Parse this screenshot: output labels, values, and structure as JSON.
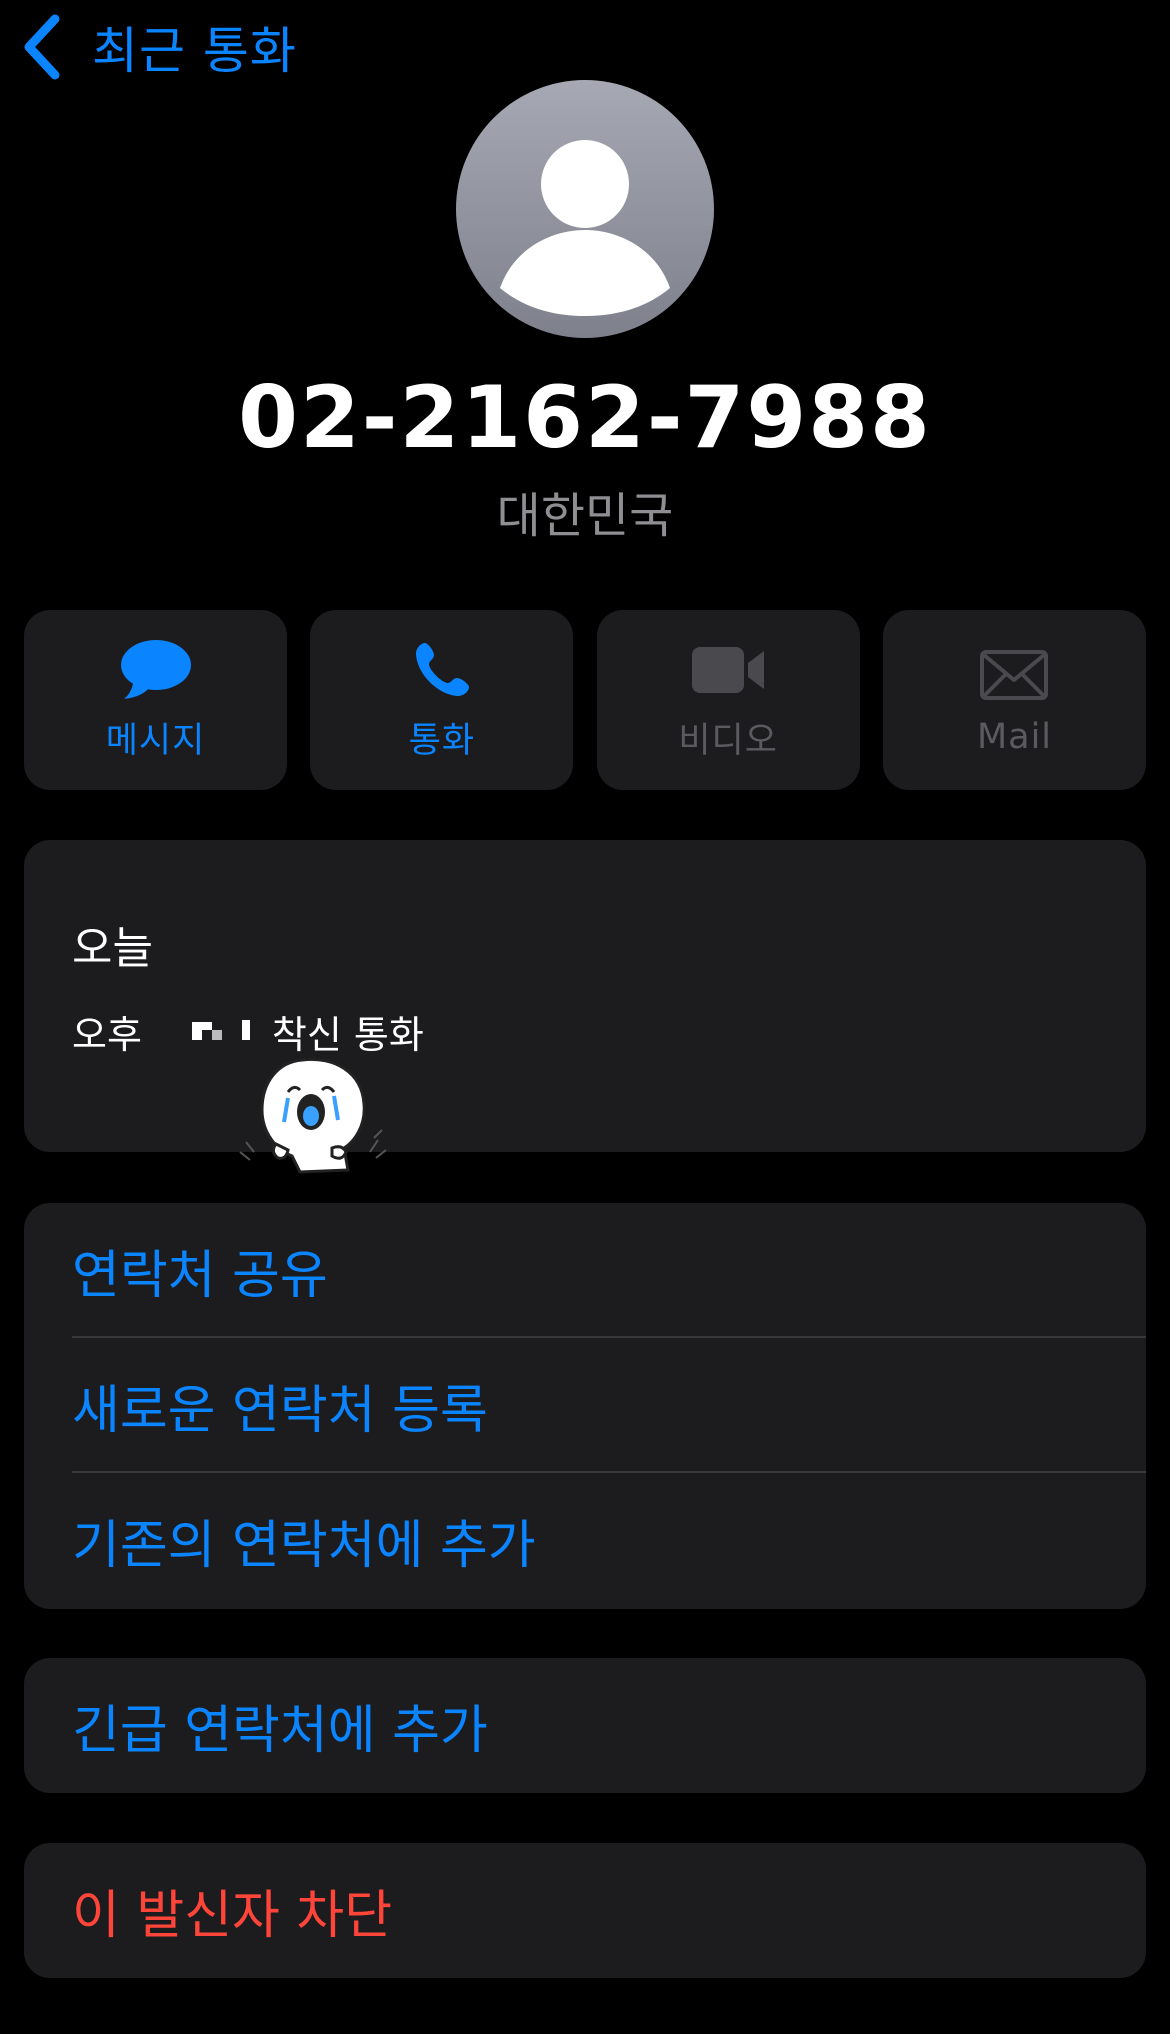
{
  "nav": {
    "back_label": "최근 통화"
  },
  "contact": {
    "phone_number": "02-2162-7988",
    "country": "대한민국"
  },
  "actions": [
    {
      "label": "메시지",
      "icon": "message-bubble-icon",
      "enabled": true
    },
    {
      "label": "통화",
      "icon": "phone-icon",
      "enabled": true
    },
    {
      "label": "비디오",
      "icon": "video-camera-icon",
      "enabled": false
    },
    {
      "label": "Mail",
      "icon": "mail-envelope-icon",
      "enabled": false
    }
  ],
  "history": {
    "date": "오늘",
    "period": "오후",
    "type": "착신 통화"
  },
  "menu": {
    "share_contact": "연락처 공유",
    "new_contact": "새로운 연락처 등록",
    "add_to_existing": "기존의 연락처에 추가"
  },
  "emergency": {
    "label": "긴급 연락처에 추가"
  },
  "block": {
    "label": "이 발신자 차단"
  },
  "colors": {
    "background": "#000000",
    "card": "#1c1c1e",
    "accent": "#0a84ff",
    "destructive": "#ff453a",
    "secondary_text": "#8e8e93",
    "disabled": "#5b5b5f"
  }
}
